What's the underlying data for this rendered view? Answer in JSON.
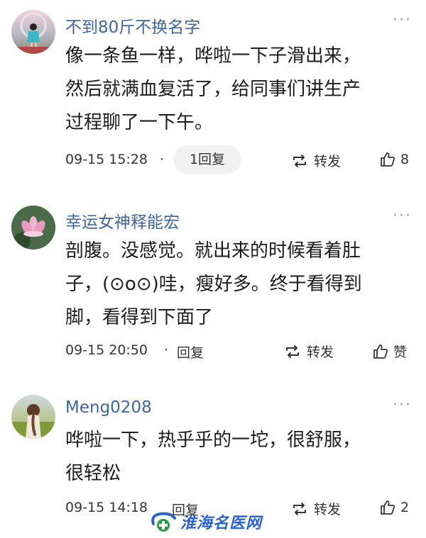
{
  "comments": [
    {
      "username": "不到80斤不换名字",
      "avatar": "avatar-girl-swing",
      "text_lines": [
        "像一条鱼一样，哗啦一下子滑出来，",
        "然后就满血复活了，给同事们讲生产",
        "过程聊了一下午。"
      ],
      "time": "09-15 15:28",
      "reply": "1回复",
      "repost": "转发",
      "like": "8"
    },
    {
      "username": "幸运女神释能宏",
      "avatar": "avatar-lotus",
      "text_lines": [
        "剖腹。没感觉。就出来的时候看着肚",
        "子，(⊙o⊙)哇，瘦好多。终于看得到",
        "脚，看得到下面了"
      ],
      "time": "09-15 20:50",
      "reply": "回复",
      "repost": "转发",
      "like": "赞"
    },
    {
      "username": "Meng0208",
      "avatar": "avatar-braid-field",
      "text_lines": [
        "哗啦一下，热乎乎的一坨，很舒服，",
        "很轻松"
      ],
      "time": "09-15 14:18",
      "reply": "回复",
      "repost": "转发",
      "like": "2"
    }
  ],
  "more_label": "···",
  "dot": "·",
  "watermark": {
    "text": "淮海名医网",
    "logo": "medical-cross-logo"
  },
  "colors": {
    "username": "#406599",
    "text": "#1c1c1c",
    "meta": "#333333",
    "pill": "#f1f1f1",
    "watermark": "#2e62c8"
  }
}
